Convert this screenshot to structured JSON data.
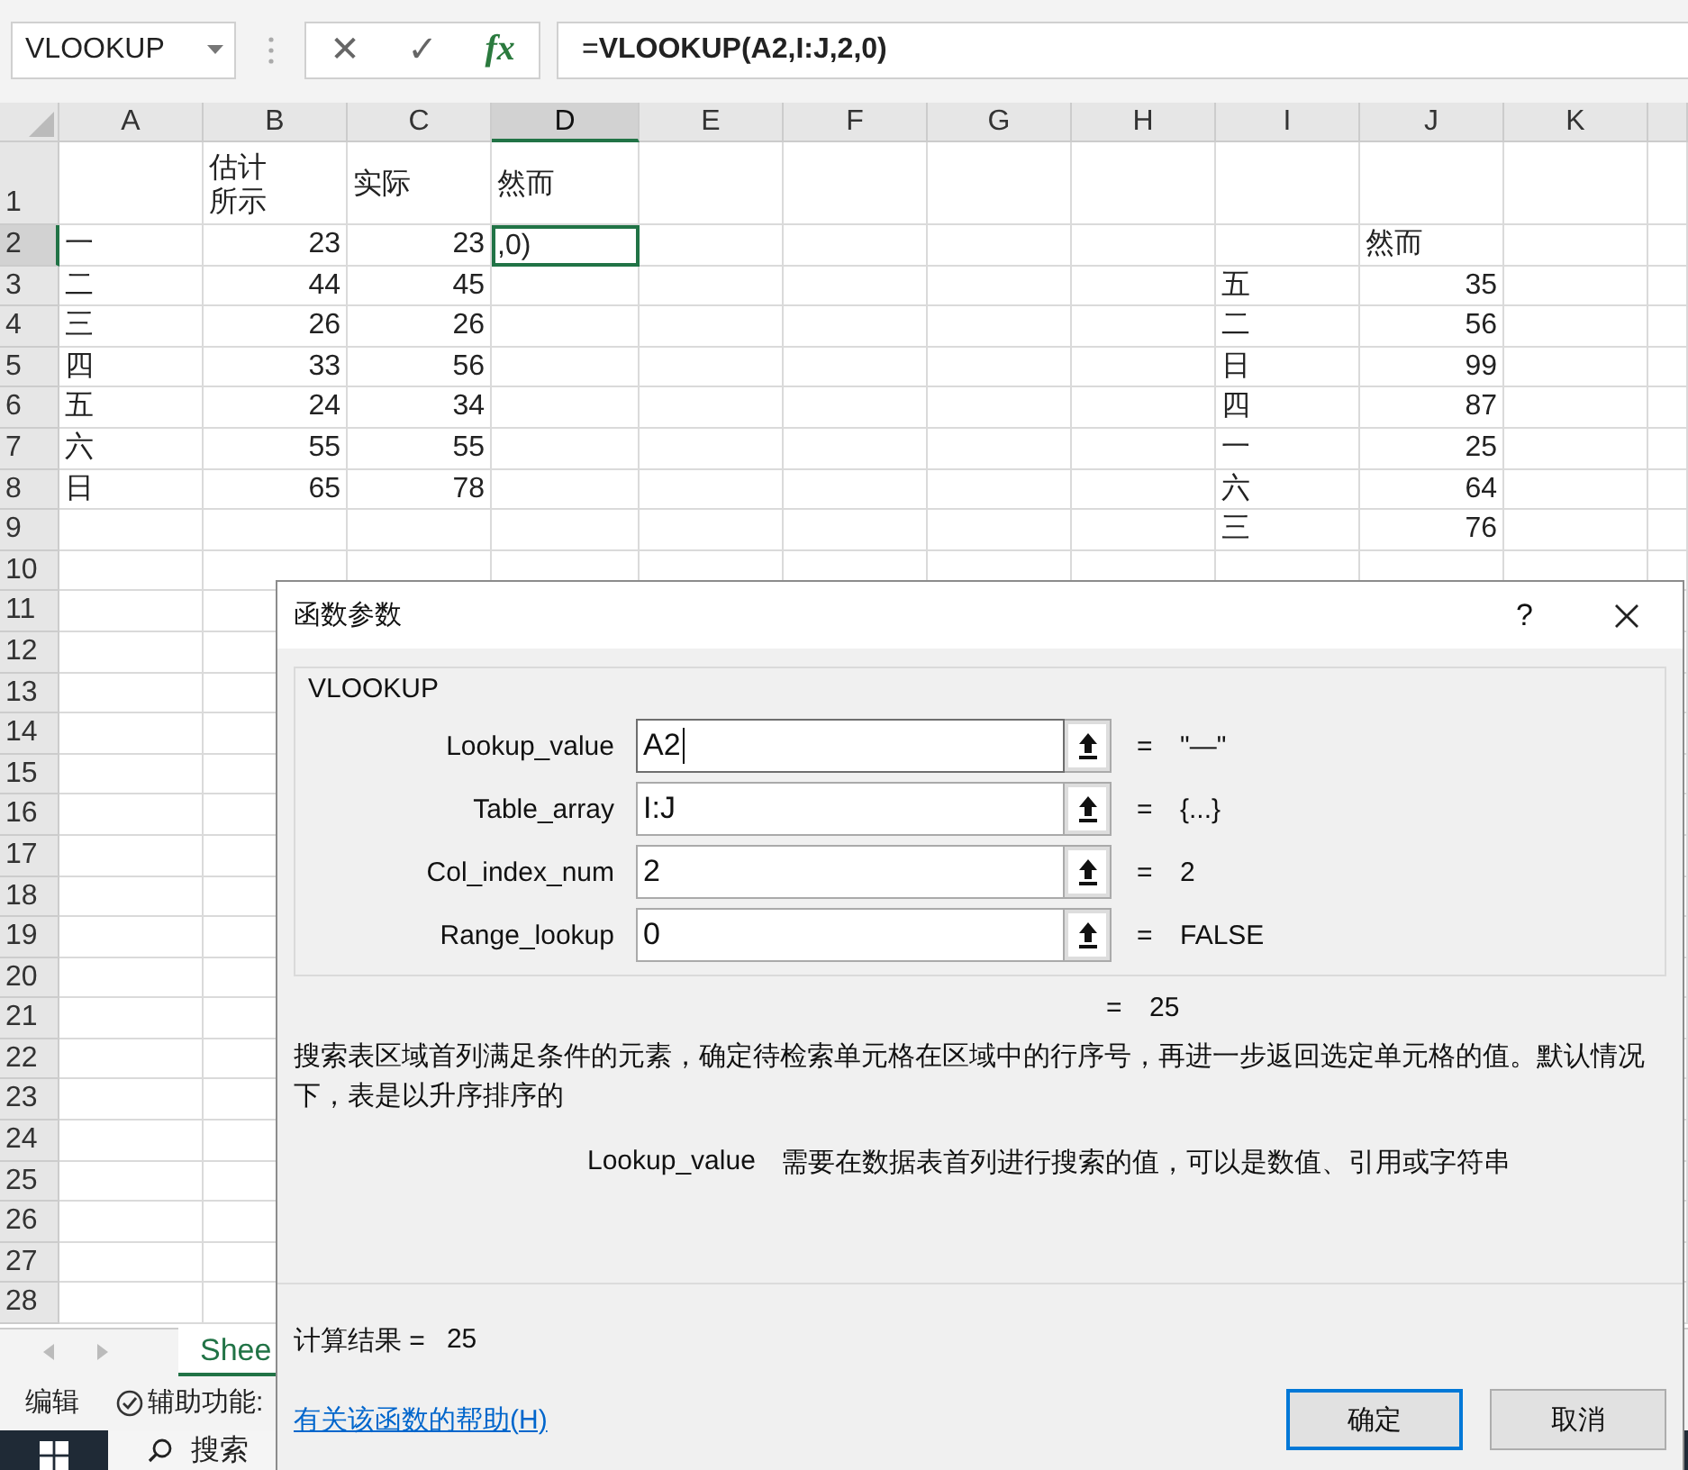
{
  "formula_bar": {
    "name_box": "VLOOKUP",
    "cancel_symbol": "✕",
    "enter_symbol": "✓",
    "function_symbol": "fx",
    "formula": "=**VLOOKUP(A2,I:J,2,0)**"
  },
  "columns": [
    {
      "label": "A",
      "selected": false
    },
    {
      "label": "B",
      "selected": false
    },
    {
      "label": "C",
      "selected": false
    },
    {
      "label": "D",
      "selected": true
    },
    {
      "label": "E",
      "selected": false
    },
    {
      "label": "F",
      "selected": false
    },
    {
      "label": "G",
      "selected": false
    },
    {
      "label": "H",
      "selected": false
    },
    {
      "label": "I",
      "selected": false
    },
    {
      "label": "J",
      "selected": false
    },
    {
      "label": "K",
      "selected": false
    }
  ],
  "rows": [
    {
      "label": "1",
      "selected": false,
      "cells": {
        "B": {
          "text": "估计所示",
          "kind": "text",
          "active": false
        },
        "C": {
          "text": "实际",
          "kind": "text",
          "active": false
        },
        "D": {
          "text": "然而",
          "kind": "text",
          "active": false
        }
      }
    },
    {
      "label": "2",
      "selected": true,
      "cells": {
        "A": {
          "text": "一",
          "kind": "text",
          "active": false
        },
        "B": {
          "text": "23",
          "kind": "number",
          "active": false
        },
        "C": {
          "text": "23",
          "kind": "number",
          "active": false
        },
        "D": {
          "text": ",0)",
          "kind": "text",
          "active": true
        },
        "J": {
          "text": "然而",
          "kind": "text",
          "active": false
        }
      }
    },
    {
      "label": "3",
      "selected": false,
      "cells": {
        "A": {
          "text": "二",
          "kind": "text",
          "active": false
        },
        "B": {
          "text": "44",
          "kind": "number",
          "active": false
        },
        "C": {
          "text": "45",
          "kind": "number",
          "active": false
        },
        "I": {
          "text": "五",
          "kind": "text",
          "active": false
        },
        "J": {
          "text": "35",
          "kind": "number",
          "active": false
        }
      }
    },
    {
      "label": "4",
      "selected": false,
      "cells": {
        "A": {
          "text": "三",
          "kind": "text",
          "active": false
        },
        "B": {
          "text": "26",
          "kind": "number",
          "active": false
        },
        "C": {
          "text": "26",
          "kind": "number",
          "active": false
        },
        "I": {
          "text": "二",
          "kind": "text",
          "active": false
        },
        "J": {
          "text": "56",
          "kind": "number",
          "active": false
        }
      }
    },
    {
      "label": "5",
      "selected": false,
      "cells": {
        "A": {
          "text": "四",
          "kind": "text",
          "active": false
        },
        "B": {
          "text": "33",
          "kind": "number",
          "active": false
        },
        "C": {
          "text": "56",
          "kind": "number",
          "active": false
        },
        "I": {
          "text": "日",
          "kind": "text",
          "active": false
        },
        "J": {
          "text": "99",
          "kind": "number",
          "active": false
        }
      }
    },
    {
      "label": "6",
      "selected": false,
      "cells": {
        "A": {
          "text": "五",
          "kind": "text",
          "active": false
        },
        "B": {
          "text": "24",
          "kind": "number",
          "active": false
        },
        "C": {
          "text": "34",
          "kind": "number",
          "active": false
        },
        "I": {
          "text": "四",
          "kind": "text",
          "active": false
        },
        "J": {
          "text": "87",
          "kind": "number",
          "active": false
        }
      }
    },
    {
      "label": "7",
      "selected": false,
      "cells": {
        "A": {
          "text": "六",
          "kind": "text",
          "active": false
        },
        "B": {
          "text": "55",
          "kind": "number",
          "active": false
        },
        "C": {
          "text": "55",
          "kind": "number",
          "active": false
        },
        "I": {
          "text": "一",
          "kind": "text",
          "active": false
        },
        "J": {
          "text": "25",
          "kind": "number",
          "active": false
        }
      }
    },
    {
      "label": "8",
      "selected": false,
      "cells": {
        "A": {
          "text": "日",
          "kind": "text",
          "active": false
        },
        "B": {
          "text": "65",
          "kind": "number",
          "active": false
        },
        "C": {
          "text": "78",
          "kind": "number",
          "active": false
        },
        "I": {
          "text": "六",
          "kind": "text",
          "active": false
        },
        "J": {
          "text": "64",
          "kind": "number",
          "active": false
        }
      }
    },
    {
      "label": "9",
      "selected": false,
      "cells": {
        "I": {
          "text": "三",
          "kind": "text",
          "active": false
        },
        "J": {
          "text": "76",
          "kind": "number",
          "active": false
        }
      }
    },
    {
      "label": "10",
      "selected": false
    },
    {
      "label": "11",
      "selected": false
    },
    {
      "label": "12",
      "selected": false
    },
    {
      "label": "13",
      "selected": false
    },
    {
      "label": "14",
      "selected": false
    },
    {
      "label": "15",
      "selected": false
    },
    {
      "label": "16",
      "selected": false
    },
    {
      "label": "17",
      "selected": false
    },
    {
      "label": "18",
      "selected": false
    },
    {
      "label": "19",
      "selected": false
    },
    {
      "label": "20",
      "selected": false
    },
    {
      "label": "21",
      "selected": false
    },
    {
      "label": "22",
      "selected": false
    },
    {
      "label": "23",
      "selected": false
    },
    {
      "label": "24",
      "selected": false
    },
    {
      "label": "25",
      "selected": false
    },
    {
      "label": "26",
      "selected": false
    },
    {
      "label": "27",
      "selected": false
    },
    {
      "label": "28",
      "selected": false
    }
  ],
  "sheet_tabs": [
    {
      "label": "Shee",
      "selected": true
    }
  ],
  "status_bar": {
    "mode": "编辑",
    "accessibility": "辅助功能:"
  },
  "taskbar": {
    "search": "搜索"
  },
  "dialog": {
    "title": "函数参数",
    "help": "?",
    "function_name": "VLOOKUP",
    "args": [
      {
        "label": "Lookup_value",
        "value": "A2",
        "sign": "=",
        "result": "\"—\"",
        "focused": true
      },
      {
        "label": "Table_array",
        "value": "I:J",
        "sign": "=",
        "result": "{...}",
        "focused": false
      },
      {
        "label": "Col_index_num",
        "value": "2",
        "sign": "=",
        "result": "2",
        "focused": false
      },
      {
        "label": "Range_lookup",
        "value": "0",
        "sign": "=",
        "result": "FALSE",
        "focused": false
      }
    ],
    "formula_result": {
      "sign": "=",
      "value": "25"
    },
    "description": "搜索表区域首列满足条件的元素，确定待检索单元格在区域中的行序号，再进一步返回选定单元格的值。默认情况下，表是以升序排序的",
    "arg_help": {
      "name": "Lookup_value",
      "text": "需要在数据表首列进行搜索的值，可以是数值、引用或字符串"
    },
    "calc_result": {
      "label": "计算结果 =",
      "value": "25"
    },
    "help_link": "有关该函数的帮助(H)",
    "buttons": [
      {
        "label": "确定",
        "default": true
      },
      {
        "label": "取消",
        "default": false
      }
    ]
  }
}
